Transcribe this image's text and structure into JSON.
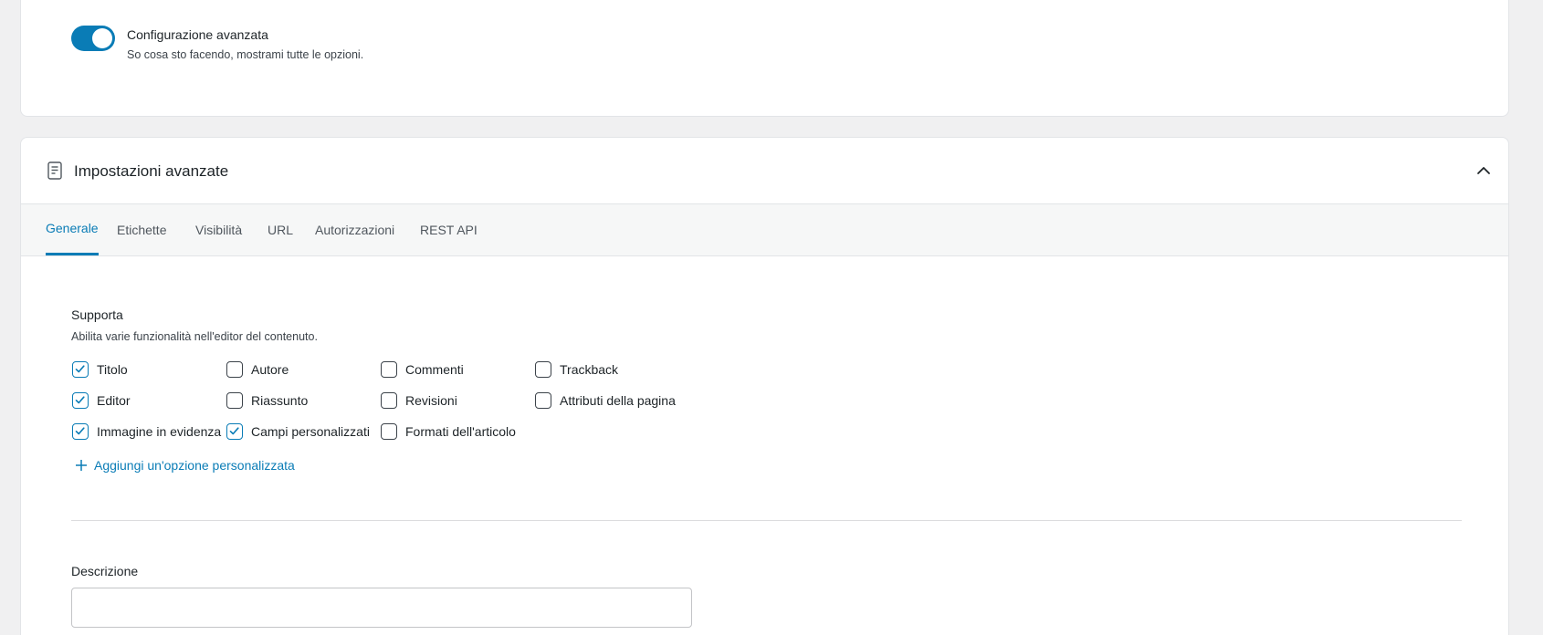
{
  "advanced_toggle": {
    "title": "Configurazione avanzata",
    "description": "So cosa sto facendo, mostrami tutte le opzioni.",
    "enabled": true,
    "color": "#0a7cb6"
  },
  "panel": {
    "title": "Impostazioni avanzate",
    "icon": "document-icon",
    "collapse_icon": "chevron-up-icon"
  },
  "tabs": [
    {
      "label": "Generale",
      "active": true
    },
    {
      "label": "Etichette",
      "active": false
    },
    {
      "label": "Visibilità",
      "active": false
    },
    {
      "label": "URL",
      "active": false
    },
    {
      "label": "Autorizzazioni",
      "active": false
    },
    {
      "label": "REST API",
      "active": false
    }
  ],
  "supports": {
    "label": "Supporta",
    "help": "Abilita varie funzionalità nell'editor del contenuto.",
    "options": [
      {
        "label": "Titolo",
        "checked": true
      },
      {
        "label": "Autore",
        "checked": false
      },
      {
        "label": "Commenti",
        "checked": false
      },
      {
        "label": "Trackback",
        "checked": false
      },
      {
        "label": "Editor",
        "checked": true
      },
      {
        "label": "Riassunto",
        "checked": false
      },
      {
        "label": "Revisioni",
        "checked": false
      },
      {
        "label": "Attributi della pagina",
        "checked": false
      },
      {
        "label": "Immagine in evidenza",
        "checked": true
      },
      {
        "label": "Campi personalizzati",
        "checked": true
      },
      {
        "label": "Formati dell'articolo",
        "checked": false
      }
    ],
    "add_custom_label": "Aggiungi un'opzione personalizzata"
  },
  "description_field": {
    "label": "Descrizione",
    "value": "",
    "placeholder": ""
  },
  "colors": {
    "accent": "#0a7cb6",
    "background": "#f0f0f1"
  }
}
